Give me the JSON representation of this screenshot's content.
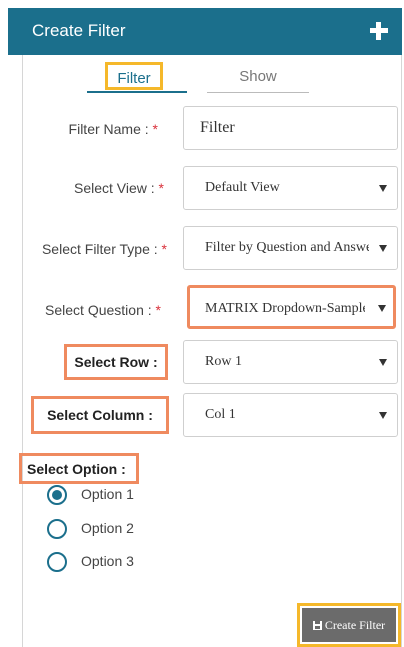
{
  "header": {
    "title": "Create Filter",
    "add_icon": "plus-icon"
  },
  "tabs": [
    {
      "label": "Filter",
      "active": true
    },
    {
      "label": "Show",
      "active": false
    }
  ],
  "form": {
    "filter_name": {
      "label": "Filter Name :",
      "required": "*",
      "value": "Filter"
    },
    "select_view": {
      "label": "Select View :",
      "required": "*",
      "value": "Default View"
    },
    "select_filter_type": {
      "label": "Select Filter Type :",
      "required": "*",
      "value": "Filter by Question and Answer"
    },
    "select_question": {
      "label": "Select Question :",
      "required": "*",
      "value": "MATRIX Dropdown-Sample"
    },
    "select_row": {
      "label": "Select Row :",
      "value": "Row 1"
    },
    "select_column": {
      "label": "Select Column :",
      "value": "Col 1"
    },
    "select_option": {
      "label": "Select Option :",
      "options": [
        "Option 1",
        "Option 2",
        "Option 3"
      ],
      "selected": "Option 1"
    }
  },
  "actions": {
    "create_label": "Create Filter",
    "create_icon": "save-icon"
  },
  "colors": {
    "header": "#1b6f8c",
    "highlight_yellow": "#f5b82a",
    "highlight_orange": "#ef8a5f",
    "required": "#d9303a",
    "button": "#6b6b6b"
  }
}
